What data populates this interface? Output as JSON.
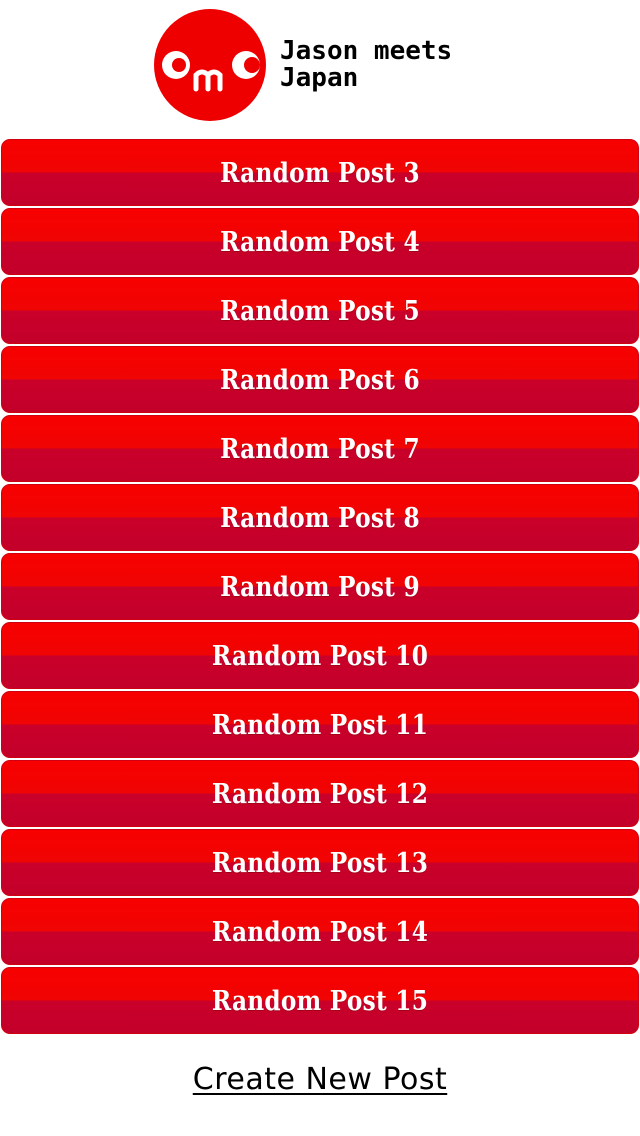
{
  "header": {
    "logo_icon": "omc-face-logo",
    "logo_letters": "OMC",
    "title_line1": "Jason meets",
    "title_line2": "Japan"
  },
  "posts": [
    {
      "label": "Random Post 3"
    },
    {
      "label": "Random Post 4"
    },
    {
      "label": "Random Post 5"
    },
    {
      "label": "Random Post 6"
    },
    {
      "label": "Random Post 7"
    },
    {
      "label": "Random Post 8"
    },
    {
      "label": "Random Post 9"
    },
    {
      "label": "Random Post 10"
    },
    {
      "label": "Random Post 11"
    },
    {
      "label": "Random Post 12"
    },
    {
      "label": "Random Post 13"
    },
    {
      "label": "Random Post 14"
    },
    {
      "label": "Random Post 15"
    }
  ],
  "footer": {
    "create_label": "Create New Post"
  },
  "colors": {
    "brand_red": "#ee0000",
    "button_top": "#f80000",
    "button_bottom": "#c3002a",
    "text_on_button": "#ffffff"
  }
}
